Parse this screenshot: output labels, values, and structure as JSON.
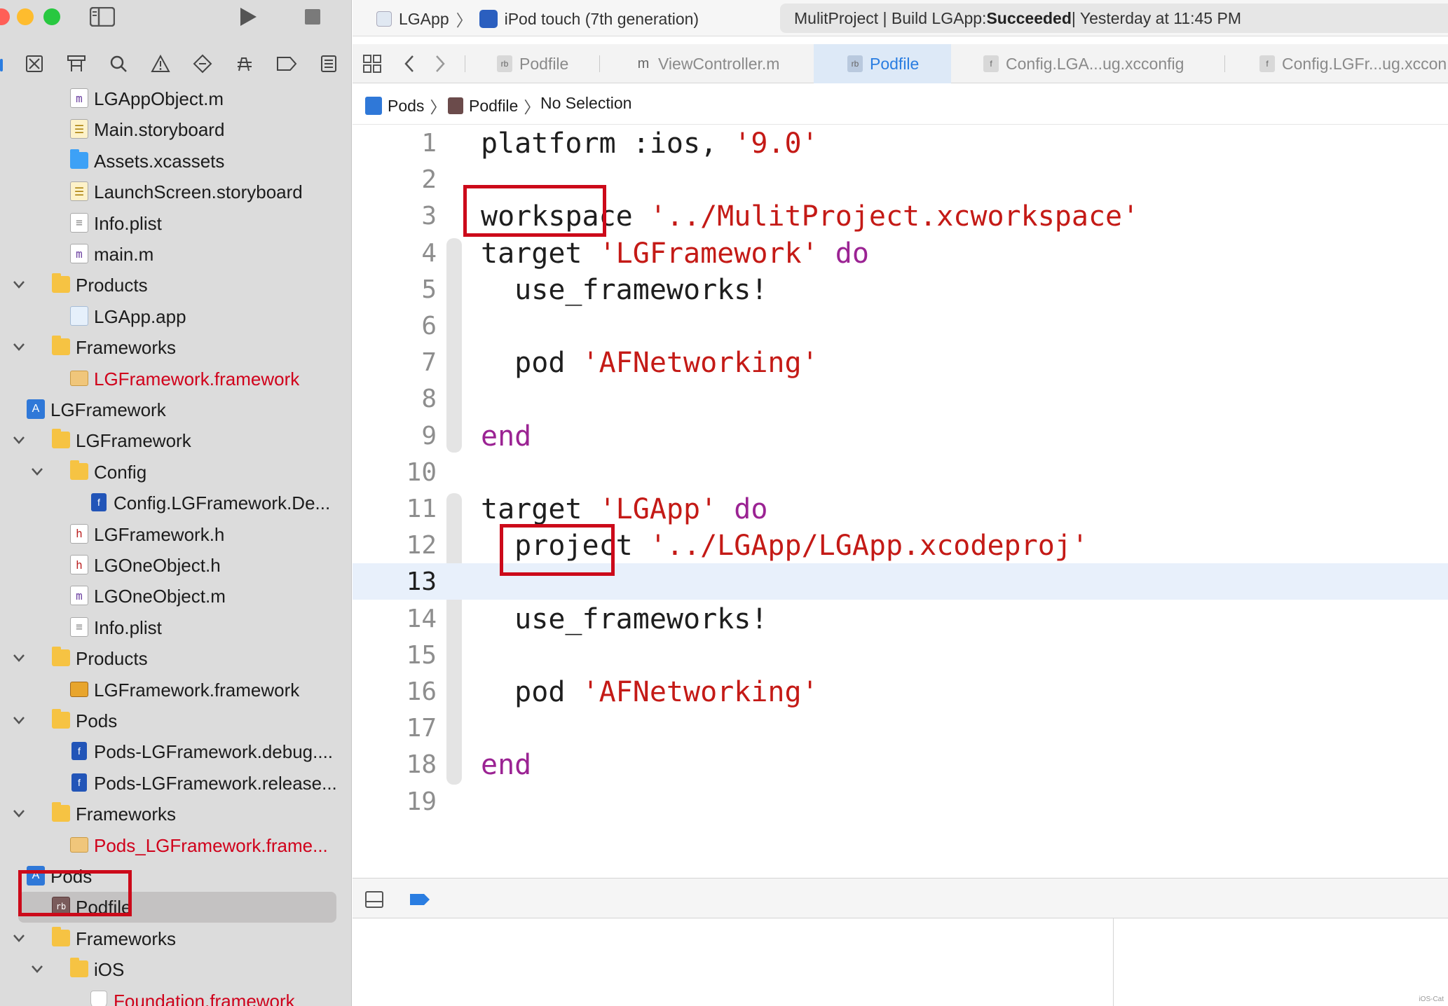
{
  "window": {
    "scheme": {
      "app": "LGApp",
      "device": "iPod touch (7th generation)"
    },
    "activity": {
      "prefix": "MulitProject | Build LGApp: ",
      "status": "Succeeded",
      "suffix": " | Yesterday at 11:45 PM"
    }
  },
  "tabs": [
    {
      "label": "Podfile",
      "icon": "rb",
      "active": false
    },
    {
      "label": "ViewController.m",
      "icon": "m",
      "active": false
    },
    {
      "label": "Podfile",
      "icon": "rb",
      "active": true
    },
    {
      "label": "Config.LGA...ug.xcconfig",
      "icon": "f",
      "active": false
    },
    {
      "label": "Config.LGFr...ug.xccon",
      "icon": "f",
      "active": false
    }
  ],
  "jumpbar": {
    "project": "Pods",
    "file": "Podfile",
    "selection": "No Selection"
  },
  "navigator": {
    "items": [
      {
        "label": "LGAppObject.m",
        "icon": "m",
        "depth": 2
      },
      {
        "label": "Main.storyboard",
        "icon": "storyboard",
        "depth": 2
      },
      {
        "label": "Assets.xcassets",
        "icon": "assets",
        "depth": 2
      },
      {
        "label": "LaunchScreen.storyboard",
        "icon": "storyboard",
        "depth": 2
      },
      {
        "label": "Info.plist",
        "icon": "plist",
        "depth": 2
      },
      {
        "label": "main.m",
        "icon": "m",
        "depth": 2
      },
      {
        "label": "Products",
        "icon": "folder",
        "depth": 1,
        "chevron": true
      },
      {
        "label": "LGApp.app",
        "icon": "app",
        "depth": 2
      },
      {
        "label": "Frameworks",
        "icon": "folder",
        "depth": 1,
        "chevron": true
      },
      {
        "label": "LGFramework.framework",
        "icon": "toolbox",
        "depth": 2,
        "red": true
      },
      {
        "label": "LGFramework",
        "icon": "project",
        "depth": 0
      },
      {
        "label": "LGFramework",
        "icon": "folder",
        "depth": 1,
        "chevron": true
      },
      {
        "label": "Config",
        "icon": "folder",
        "depth": 2,
        "chevron": true
      },
      {
        "label": "Config.LGFramework.De...",
        "icon": "config",
        "depth": 3
      },
      {
        "label": "LGFramework.h",
        "icon": "h",
        "depth": 2
      },
      {
        "label": "LGOneObject.h",
        "icon": "h",
        "depth": 2
      },
      {
        "label": "LGOneObject.m",
        "icon": "m",
        "depth": 2
      },
      {
        "label": "Info.plist",
        "icon": "plist",
        "depth": 2
      },
      {
        "label": "Products",
        "icon": "folder",
        "depth": 1,
        "chevron": true
      },
      {
        "label": "LGFramework.framework",
        "icon": "toolbox-dark",
        "depth": 2
      },
      {
        "label": "Pods",
        "icon": "folder",
        "depth": 1,
        "chevron": true
      },
      {
        "label": "Pods-LGFramework.debug....",
        "icon": "config",
        "depth": 2
      },
      {
        "label": "Pods-LGFramework.release...",
        "icon": "config",
        "depth": 2
      },
      {
        "label": "Frameworks",
        "icon": "folder",
        "depth": 1,
        "chevron": true
      },
      {
        "label": "Pods_LGFramework.frame...",
        "icon": "toolbox",
        "depth": 2,
        "red": true
      },
      {
        "label": "Pods",
        "icon": "project",
        "depth": 0
      },
      {
        "label": "Podfile",
        "icon": "rb",
        "depth": 1,
        "selected": true
      },
      {
        "label": "Frameworks",
        "icon": "folder",
        "depth": 1,
        "chevron": true
      },
      {
        "label": "iOS",
        "icon": "folder",
        "depth": 2,
        "chevron": true
      },
      {
        "label": "Foundation.framework",
        "icon": "shield",
        "depth": 3,
        "red": true
      }
    ]
  },
  "editor": {
    "current_line": 13,
    "lines": [
      {
        "n": "1",
        "tokens": [
          [
            "plain",
            "platform :ios, "
          ],
          [
            "str",
            "'9.0'"
          ]
        ]
      },
      {
        "n": "2",
        "tokens": []
      },
      {
        "n": "3",
        "tokens": [
          [
            "plain",
            "workspace "
          ],
          [
            "str",
            "'../MulitProject.xcworkspace'"
          ]
        ]
      },
      {
        "n": "4",
        "tokens": [
          [
            "plain",
            "target "
          ],
          [
            "str",
            "'LGFramework'"
          ],
          [
            "plain",
            " "
          ],
          [
            "kw",
            "do"
          ]
        ]
      },
      {
        "n": "5",
        "tokens": [
          [
            "plain",
            "  use_frameworks!"
          ]
        ]
      },
      {
        "n": "6",
        "tokens": []
      },
      {
        "n": "7",
        "tokens": [
          [
            "plain",
            "  pod "
          ],
          [
            "str",
            "'AFNetworking'"
          ]
        ]
      },
      {
        "n": "8",
        "tokens": []
      },
      {
        "n": "9",
        "tokens": [
          [
            "kw",
            "end"
          ]
        ]
      },
      {
        "n": "10",
        "tokens": []
      },
      {
        "n": "11",
        "tokens": [
          [
            "plain",
            "target "
          ],
          [
            "str",
            "'LGApp'"
          ],
          [
            "plain",
            " "
          ],
          [
            "kw",
            "do"
          ]
        ]
      },
      {
        "n": "12",
        "tokens": [
          [
            "plain",
            "  project "
          ],
          [
            "str",
            "'../LGApp/LGApp.xcodeproj'"
          ]
        ]
      },
      {
        "n": "13",
        "tokens": []
      },
      {
        "n": "14",
        "tokens": [
          [
            "plain",
            "  use_frameworks!"
          ]
        ]
      },
      {
        "n": "15",
        "tokens": []
      },
      {
        "n": "16",
        "tokens": [
          [
            "plain",
            "  pod "
          ],
          [
            "str",
            "'AFNetworking'"
          ]
        ]
      },
      {
        "n": "17",
        "tokens": []
      },
      {
        "n": "18",
        "tokens": [
          [
            "kw",
            "end"
          ]
        ]
      },
      {
        "n": "19",
        "tokens": []
      }
    ]
  },
  "colors": {
    "keyword": "#9b2393",
    "string": "#c41a16",
    "highlight_box": "#cc0a1a",
    "accent": "#2a7de1"
  },
  "watermark": "iOS-Cat"
}
